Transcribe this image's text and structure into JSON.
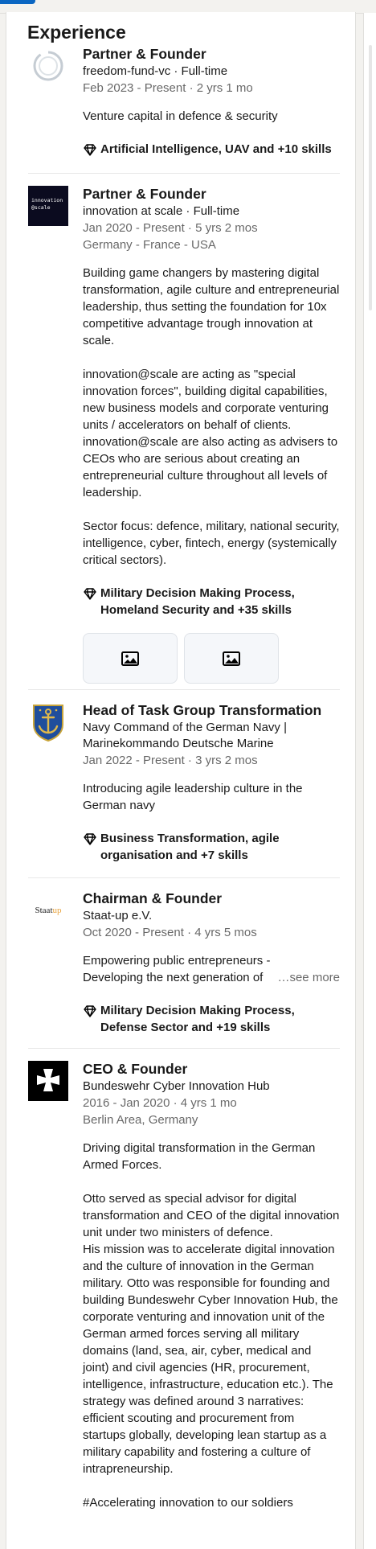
{
  "section": {
    "title": "Experience"
  },
  "entries": [
    {
      "title": "Partner & Founder",
      "company": "freedom-fund-vc · Full-time",
      "dates": "Feb 2023 - Present · 2 yrs 1 mo",
      "description": "Venture capital in defence & security",
      "skills": "Artificial Intelligence, UAV and +10 skills"
    },
    {
      "title": "Partner & Founder",
      "company": "innovation at scale · Full-time",
      "dates": "Jan 2020 - Present · 5 yrs 2 mos",
      "location": "Germany - France - USA",
      "logo_text": "innovation\n@scale",
      "description": "Building game changers by mastering digital transformation, agile culture and entrepreneurial leadership, thus setting the foundation for 10x competitive advantage trough innovation at scale.\n\ninnovation@scale are acting as \"special innovation forces\", building digital capabilities, new business models and corporate venturing units / accelerators on behalf of clients. innovation@scale are also acting as advisers to CEOs who are serious about creating an entrepreneurial culture throughout all levels of leadership.\n\nSector focus: defence, military, national security, intelligence, cyber, fintech, energy (systemically critical sectors).",
      "skills": "Military Decision Making Process, Homeland Security and +35 skills"
    },
    {
      "title": "Head of Task Group Transformation",
      "company": "Navy Command of the German Navy | Marinekommando Deutsche Marine",
      "dates": "Jan 2022 - Present · 3 yrs 2 mos",
      "description": "Introducing agile leadership culture in the German navy",
      "skills": "Business Transformation, agile organisation and +7 skills"
    },
    {
      "title": "Chairman & Founder",
      "company": "Staat-up e.V.",
      "dates": "Oct 2020 - Present · 4 yrs 5 mos",
      "logo_text_a": "Staat",
      "logo_text_b": "up",
      "desc_line1": "Empowering public entrepreneurs -",
      "desc_line2": "Developing the next generation of",
      "see_more": "…see more",
      "skills": "Military Decision Making Process, Defense Sector and +19 skills"
    },
    {
      "title": "CEO & Founder",
      "company": "Bundeswehr Cyber Innovation Hub",
      "dates": "2016 - Jan 2020 · 4 yrs 1 mo",
      "location": "Berlin Area, Germany",
      "description": "Driving digital transformation in the German Armed Forces.\n\nOtto served as special advisor for digital transformation and CEO of the digital innovation unit under two ministers of defence.\nHis mission was to accelerate digital innovation and the culture of innovation in the German military. Otto was responsible for founding and building Bundeswehr Cyber Innovation Hub, the corporate venturing and innovation unit of the German armed forces serving all military domains (land, sea, air, cyber, medical and joint) and civil agencies (HR, procurement, intelligence, infrastructure, education etc.). The strategy was defined around 3 narratives: efficient scouting and procurement from startups globally, developing lean startup as a military capability and fostering a culture of intrapreneurship.\n\n#Accelerating innovation to our soldiers"
    }
  ],
  "colors": {
    "accent": "#0a66c2",
    "staatup_orange": "#e8a33d"
  },
  "icons": [
    "skill-diamond-icon",
    "image-icon"
  ]
}
